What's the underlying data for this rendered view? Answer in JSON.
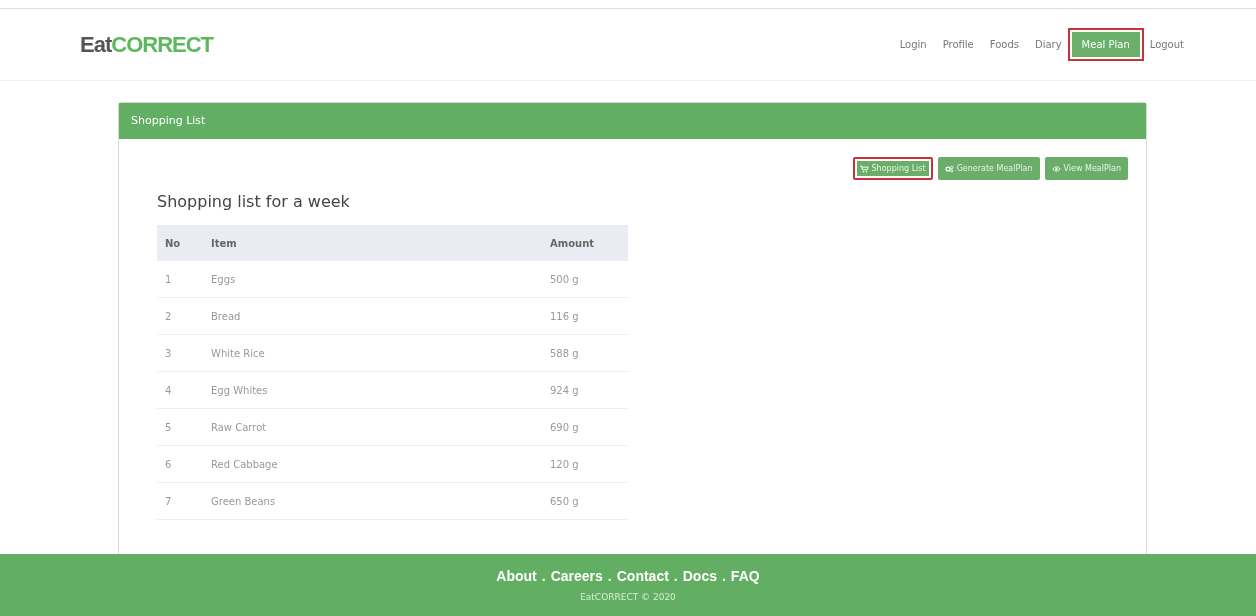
{
  "logo": {
    "prefix": "Eat",
    "accent": "CORRECT"
  },
  "nav": [
    {
      "label": "Login",
      "selected": false,
      "highlighted": false
    },
    {
      "label": "Profile",
      "selected": false,
      "highlighted": false
    },
    {
      "label": "Foods",
      "selected": false,
      "highlighted": false
    },
    {
      "label": "Diary",
      "selected": false,
      "highlighted": false
    },
    {
      "label": "Meal Plan",
      "selected": true,
      "highlighted": true
    },
    {
      "label": "Logout",
      "selected": false,
      "highlighted": false
    }
  ],
  "panel": {
    "title": "Shopping List",
    "buttons": [
      {
        "label": "Shopping List",
        "kind": "cart",
        "highlighted": true
      },
      {
        "label": "Generate MealPlan",
        "kind": "gears",
        "highlighted": false
      },
      {
        "label": "View MealPlan",
        "kind": "eye",
        "highlighted": false
      }
    ],
    "heading": "Shopping list for a week",
    "table": {
      "columns": [
        "No",
        "Item",
        "Amount"
      ],
      "rows": [
        [
          "1",
          "Eggs",
          "500 g"
        ],
        [
          "2",
          "Bread",
          "116 g"
        ],
        [
          "3",
          "White Rice",
          "588 g"
        ],
        [
          "4",
          "Egg Whites",
          "924 g"
        ],
        [
          "5",
          "Raw Carrot",
          "690 g"
        ],
        [
          "6",
          "Red Cabbage",
          "120 g"
        ],
        [
          "7",
          "Green Beans",
          "650 g"
        ]
      ]
    }
  },
  "footer": {
    "links": [
      "About",
      "Careers",
      "Contact",
      "Docs",
      "FAQ"
    ],
    "separator": ".",
    "copyright": "EatCORRECT © 2020"
  }
}
